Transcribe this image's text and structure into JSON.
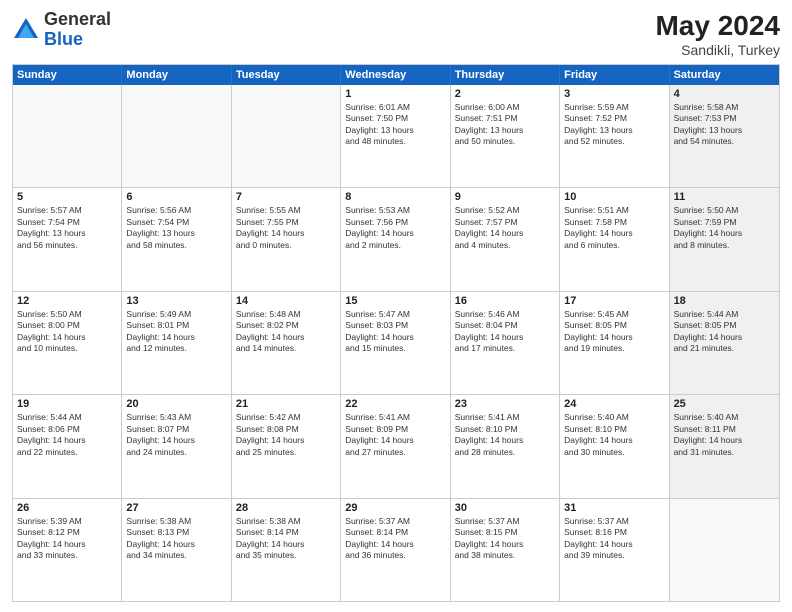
{
  "logo": {
    "general": "General",
    "blue": "Blue"
  },
  "title": {
    "month_year": "May 2024",
    "location": "Sandikli, Turkey"
  },
  "day_headers": [
    "Sunday",
    "Monday",
    "Tuesday",
    "Wednesday",
    "Thursday",
    "Friday",
    "Saturday"
  ],
  "weeks": [
    [
      {
        "day": "",
        "info": "",
        "empty": true
      },
      {
        "day": "",
        "info": "",
        "empty": true
      },
      {
        "day": "",
        "info": "",
        "empty": true
      },
      {
        "day": "1",
        "info": "Sunrise: 6:01 AM\nSunset: 7:50 PM\nDaylight: 13 hours\nand 48 minutes."
      },
      {
        "day": "2",
        "info": "Sunrise: 6:00 AM\nSunset: 7:51 PM\nDaylight: 13 hours\nand 50 minutes."
      },
      {
        "day": "3",
        "info": "Sunrise: 5:59 AM\nSunset: 7:52 PM\nDaylight: 13 hours\nand 52 minutes."
      },
      {
        "day": "4",
        "info": "Sunrise: 5:58 AM\nSunset: 7:53 PM\nDaylight: 13 hours\nand 54 minutes.",
        "shaded": true
      }
    ],
    [
      {
        "day": "5",
        "info": "Sunrise: 5:57 AM\nSunset: 7:54 PM\nDaylight: 13 hours\nand 56 minutes."
      },
      {
        "day": "6",
        "info": "Sunrise: 5:56 AM\nSunset: 7:54 PM\nDaylight: 13 hours\nand 58 minutes."
      },
      {
        "day": "7",
        "info": "Sunrise: 5:55 AM\nSunset: 7:55 PM\nDaylight: 14 hours\nand 0 minutes."
      },
      {
        "day": "8",
        "info": "Sunrise: 5:53 AM\nSunset: 7:56 PM\nDaylight: 14 hours\nand 2 minutes."
      },
      {
        "day": "9",
        "info": "Sunrise: 5:52 AM\nSunset: 7:57 PM\nDaylight: 14 hours\nand 4 minutes."
      },
      {
        "day": "10",
        "info": "Sunrise: 5:51 AM\nSunset: 7:58 PM\nDaylight: 14 hours\nand 6 minutes."
      },
      {
        "day": "11",
        "info": "Sunrise: 5:50 AM\nSunset: 7:59 PM\nDaylight: 14 hours\nand 8 minutes.",
        "shaded": true
      }
    ],
    [
      {
        "day": "12",
        "info": "Sunrise: 5:50 AM\nSunset: 8:00 PM\nDaylight: 14 hours\nand 10 minutes."
      },
      {
        "day": "13",
        "info": "Sunrise: 5:49 AM\nSunset: 8:01 PM\nDaylight: 14 hours\nand 12 minutes."
      },
      {
        "day": "14",
        "info": "Sunrise: 5:48 AM\nSunset: 8:02 PM\nDaylight: 14 hours\nand 14 minutes."
      },
      {
        "day": "15",
        "info": "Sunrise: 5:47 AM\nSunset: 8:03 PM\nDaylight: 14 hours\nand 15 minutes."
      },
      {
        "day": "16",
        "info": "Sunrise: 5:46 AM\nSunset: 8:04 PM\nDaylight: 14 hours\nand 17 minutes."
      },
      {
        "day": "17",
        "info": "Sunrise: 5:45 AM\nSunset: 8:05 PM\nDaylight: 14 hours\nand 19 minutes."
      },
      {
        "day": "18",
        "info": "Sunrise: 5:44 AM\nSunset: 8:05 PM\nDaylight: 14 hours\nand 21 minutes.",
        "shaded": true
      }
    ],
    [
      {
        "day": "19",
        "info": "Sunrise: 5:44 AM\nSunset: 8:06 PM\nDaylight: 14 hours\nand 22 minutes."
      },
      {
        "day": "20",
        "info": "Sunrise: 5:43 AM\nSunset: 8:07 PM\nDaylight: 14 hours\nand 24 minutes."
      },
      {
        "day": "21",
        "info": "Sunrise: 5:42 AM\nSunset: 8:08 PM\nDaylight: 14 hours\nand 25 minutes."
      },
      {
        "day": "22",
        "info": "Sunrise: 5:41 AM\nSunset: 8:09 PM\nDaylight: 14 hours\nand 27 minutes."
      },
      {
        "day": "23",
        "info": "Sunrise: 5:41 AM\nSunset: 8:10 PM\nDaylight: 14 hours\nand 28 minutes."
      },
      {
        "day": "24",
        "info": "Sunrise: 5:40 AM\nSunset: 8:10 PM\nDaylight: 14 hours\nand 30 minutes."
      },
      {
        "day": "25",
        "info": "Sunrise: 5:40 AM\nSunset: 8:11 PM\nDaylight: 14 hours\nand 31 minutes.",
        "shaded": true
      }
    ],
    [
      {
        "day": "26",
        "info": "Sunrise: 5:39 AM\nSunset: 8:12 PM\nDaylight: 14 hours\nand 33 minutes."
      },
      {
        "day": "27",
        "info": "Sunrise: 5:38 AM\nSunset: 8:13 PM\nDaylight: 14 hours\nand 34 minutes."
      },
      {
        "day": "28",
        "info": "Sunrise: 5:38 AM\nSunset: 8:14 PM\nDaylight: 14 hours\nand 35 minutes."
      },
      {
        "day": "29",
        "info": "Sunrise: 5:37 AM\nSunset: 8:14 PM\nDaylight: 14 hours\nand 36 minutes."
      },
      {
        "day": "30",
        "info": "Sunrise: 5:37 AM\nSunset: 8:15 PM\nDaylight: 14 hours\nand 38 minutes."
      },
      {
        "day": "31",
        "info": "Sunrise: 5:37 AM\nSunset: 8:16 PM\nDaylight: 14 hours\nand 39 minutes."
      },
      {
        "day": "",
        "info": "",
        "empty": true,
        "shaded": true
      }
    ]
  ]
}
